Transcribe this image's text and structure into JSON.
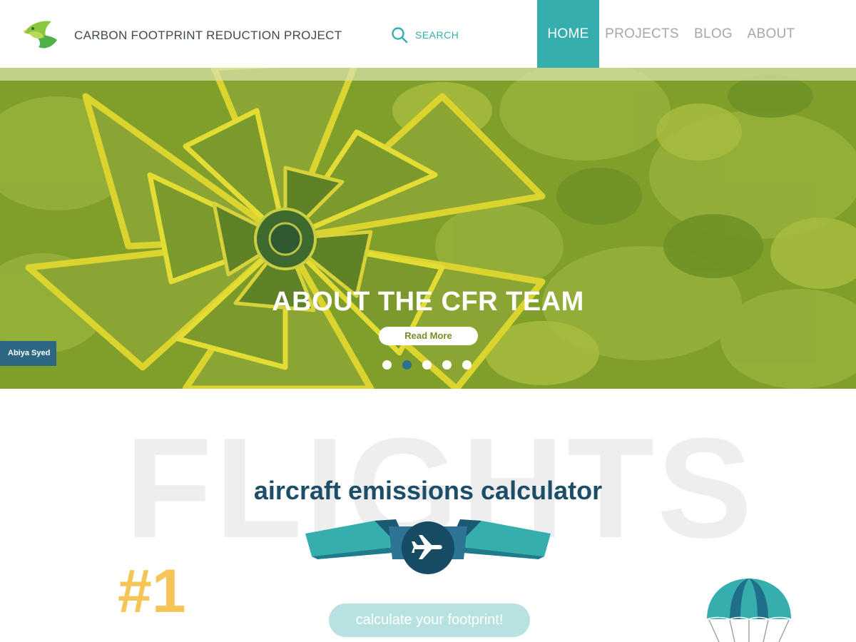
{
  "header": {
    "logo_icon": "bird-leaf-logo",
    "site_title": "CARBON FOOTPRINT REDUCTION PROJECT",
    "search": {
      "icon": "search-icon",
      "label": "SEARCH"
    },
    "nav": [
      {
        "label": "HOME",
        "active": true
      },
      {
        "label": "PROJECTS",
        "active": false
      },
      {
        "label": "BLOG",
        "active": false
      },
      {
        "label": "ABOUT",
        "active": false
      }
    ]
  },
  "hero": {
    "title": "ABOUT THE CFR TEAM",
    "button_label": "Read More",
    "credit": "Abiya Syed",
    "slides_total": 5,
    "active_slide": 2
  },
  "calculator": {
    "background_word": "FLIGHTS",
    "title": "aircraft emissions calculator",
    "badge_icon": "airplane-icon",
    "rank": "#1",
    "cta_label": "calculate your footprint!",
    "decoration_icon": "parachute-icon"
  },
  "colors": {
    "accent_teal": "#36aeae",
    "navy": "#1c4e6a",
    "hero_green": "#7f9f2a",
    "hero_yellow": "#dbd42e",
    "rank_yellow": "#f6c557",
    "cta_bg": "#b8e2e1"
  }
}
